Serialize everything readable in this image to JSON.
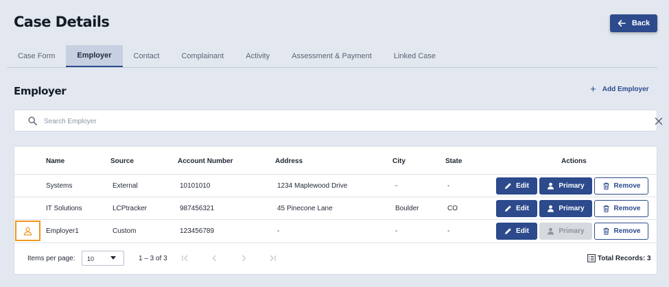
{
  "header": {
    "title": "Case Details",
    "back_label": "Back"
  },
  "tabs": [
    {
      "label": "Case Form",
      "active": false
    },
    {
      "label": "Employer",
      "active": true
    },
    {
      "label": "Contact",
      "active": false
    },
    {
      "label": "Complainant",
      "active": false
    },
    {
      "label": "Activity",
      "active": false
    },
    {
      "label": "Assessment & Payment",
      "active": false
    },
    {
      "label": "Linked Case",
      "active": false
    }
  ],
  "section": {
    "title": "Employer",
    "add_label": "Add Employer"
  },
  "search": {
    "placeholder": "Search Employer",
    "value": ""
  },
  "table": {
    "columns": [
      "Name",
      "Source",
      "Account Number",
      "Address",
      "City",
      "State",
      "Actions"
    ],
    "rows": [
      {
        "name": "Systems",
        "source": "External",
        "account": "10101010",
        "address": "1234 Maplewood Drive",
        "city": "-",
        "state": "-",
        "primary_enabled": true,
        "is_primary": false
      },
      {
        "name": "IT Solutions",
        "source": "LCPtracker",
        "account": "987456321",
        "address": "45 Pinecone Lane",
        "city": "Boulder",
        "state": "CO",
        "primary_enabled": true,
        "is_primary": false
      },
      {
        "name": "Employer1",
        "source": "Custom",
        "account": "123456789",
        "address": "-",
        "city": "-",
        "state": "-",
        "primary_enabled": false,
        "is_primary": true
      }
    ],
    "actions": {
      "edit_label": "Edit",
      "primary_label": "Primary",
      "remove_label": "Remove"
    }
  },
  "footer": {
    "items_per_page_label": "Items per page:",
    "items_per_page_value": "10",
    "range": "1 – 3 of 3",
    "total_records": "Total Records: 3"
  },
  "colors": {
    "background": "#e3e8f0",
    "accent": "#2c4a8c",
    "primary_marker": "#f0961e",
    "disabled": "#d6d9de"
  }
}
